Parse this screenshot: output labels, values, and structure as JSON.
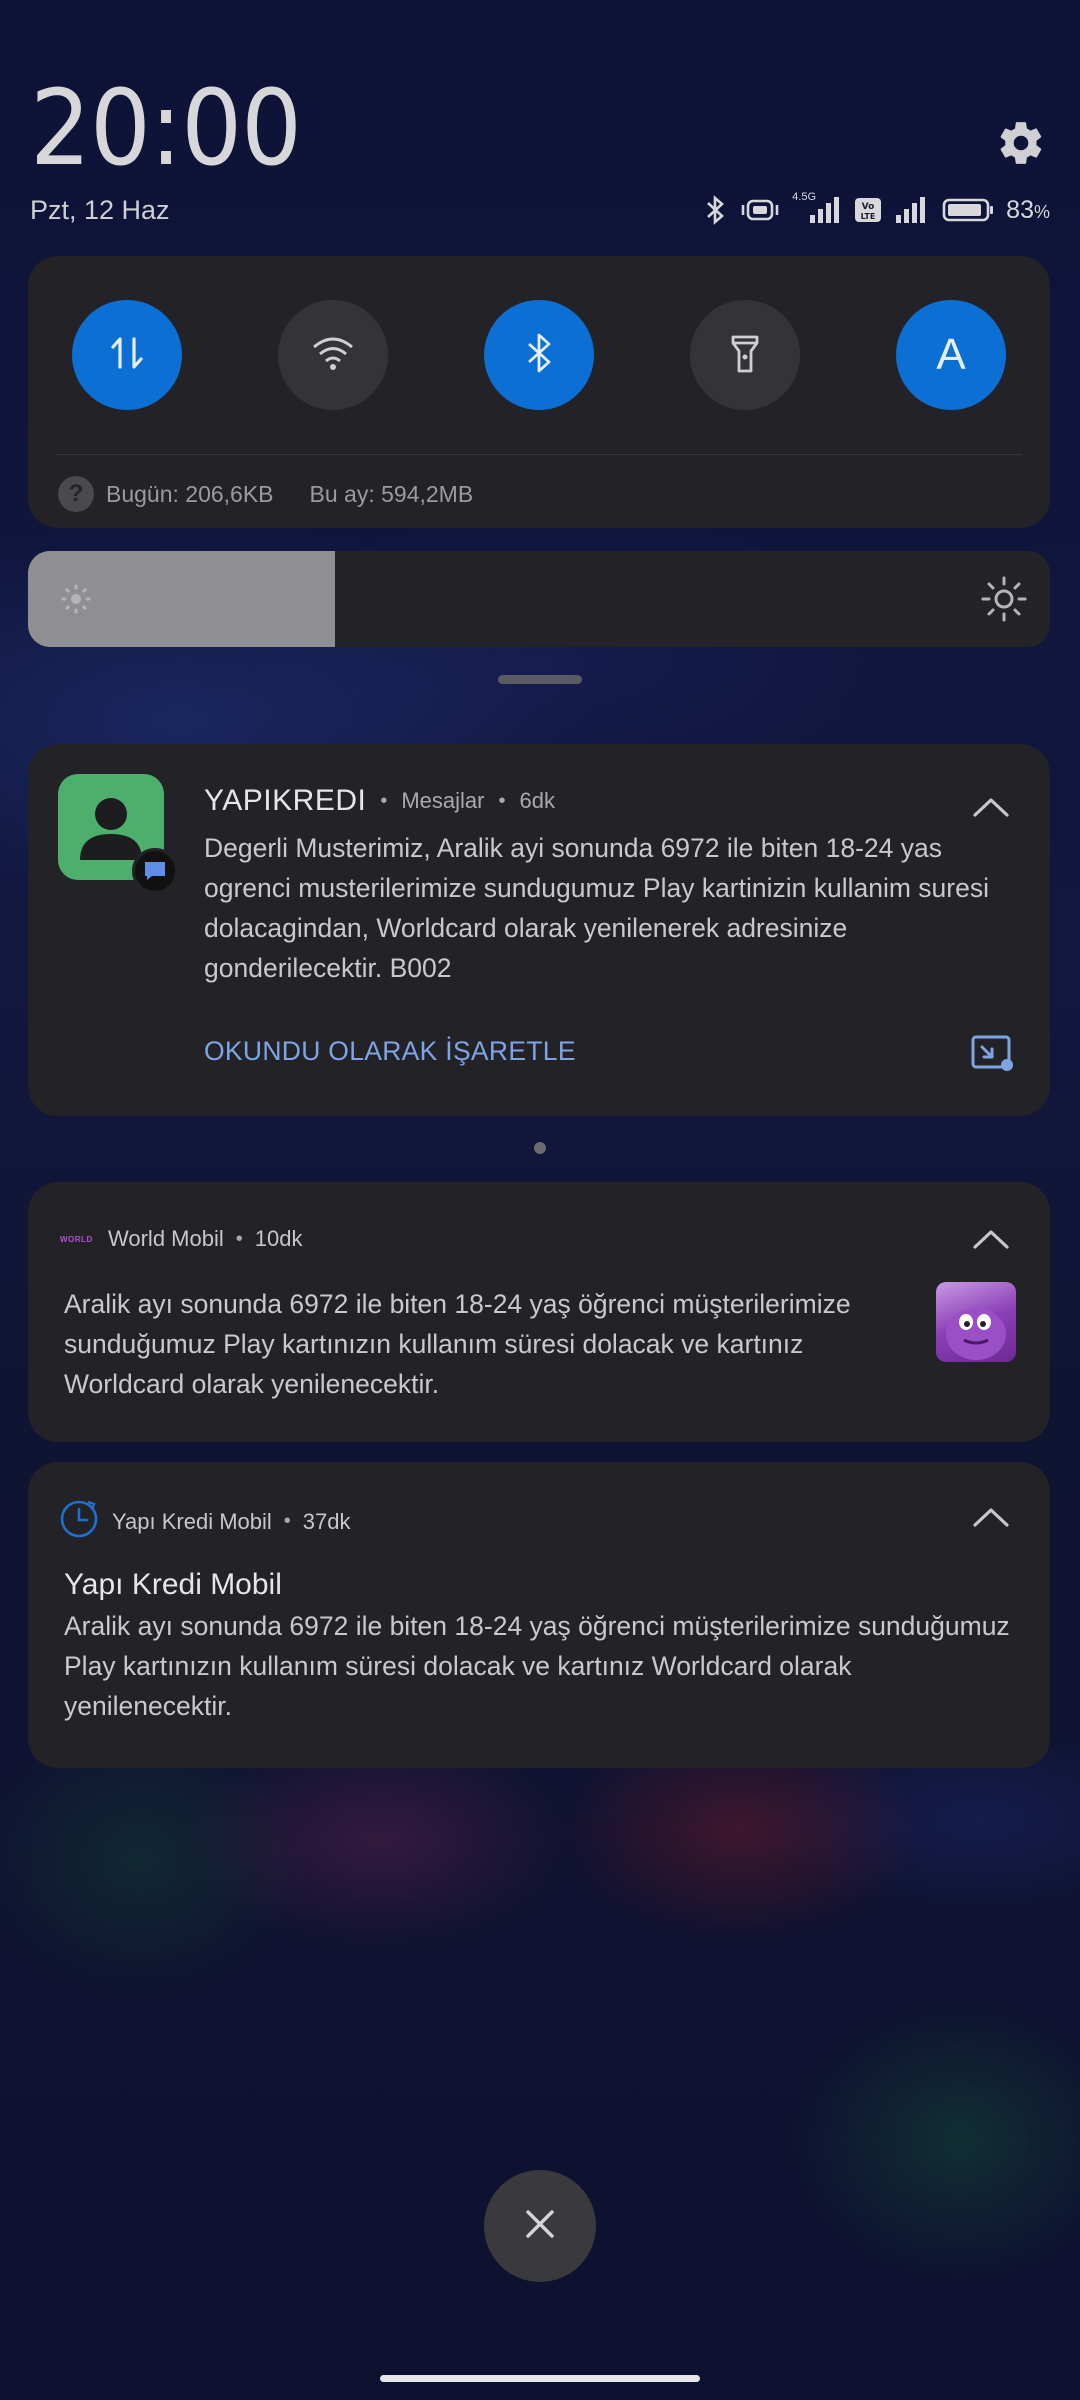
{
  "header": {
    "time": "20:00",
    "date": "Pzt, 12 Haz",
    "settings_icon": "gear-icon"
  },
  "status_bar": {
    "icons": [
      "bluetooth-icon",
      "vibrate-icon",
      "signal-4.5g-icon",
      "volte-icon",
      "signal-icon",
      "battery-icon"
    ],
    "network_label": "4.5G",
    "battery_percent": "83",
    "battery_unit": "%"
  },
  "quick_settings": {
    "tiles": [
      {
        "name": "mobile-data",
        "icon": "data-transfer-icon",
        "active": true
      },
      {
        "name": "wifi",
        "icon": "wifi-icon",
        "active": false
      },
      {
        "name": "bluetooth",
        "icon": "bluetooth-icon",
        "active": true
      },
      {
        "name": "flashlight",
        "icon": "flashlight-icon",
        "active": false
      },
      {
        "name": "auto-brightness",
        "icon": "letter-a-icon",
        "label": "A",
        "active": true
      }
    ],
    "usage_today": "Bugün: 206,6KB",
    "usage_month": "Bu ay: 594,2MB"
  },
  "brightness": {
    "level": 0.3,
    "fill_color": "#8f8f93"
  },
  "notifications": [
    {
      "app_title": "YAPIKREDI",
      "category": "Mesajlar",
      "age": "6dk",
      "body": "Degerli Musterimiz, Aralik ayi sonunda 6972 ile biten 18-24 yas ogrenci musterilerimize sundugumuz Play kartinizin kullanim suresi dolacagindan, Worldcard olarak yenilenerek adresinize gonderilecektir. B002",
      "action": "OKUNDU OLARAK İŞARETLE"
    },
    {
      "app_logo": "WORLD",
      "app_name": "World Mobil",
      "age": "10dk",
      "body": "Aralik  ayı sonunda 6972 ile biten 18-24 yaş öğrenci müşterilerimize sunduğumuz Play kartınızın kullanım süresi dolacak ve kartınız Worldcard olarak yenilenecektir."
    },
    {
      "app_name": "Yapı Kredi Mobil",
      "age": "37dk",
      "title": "Yapı Kredi Mobil",
      "body": "Aralik  ayı sonunda 6972 ile biten 18-24 yaş öğrenci müşterilerimize sunduğumuz Play kartınızın kullanım süresi dolacak ve kartınız Worldcard olarak yenilenecektir."
    }
  ],
  "colors": {
    "accent": "#0c6fd3",
    "action_link": "#7fa4e6",
    "card": "#232327"
  }
}
